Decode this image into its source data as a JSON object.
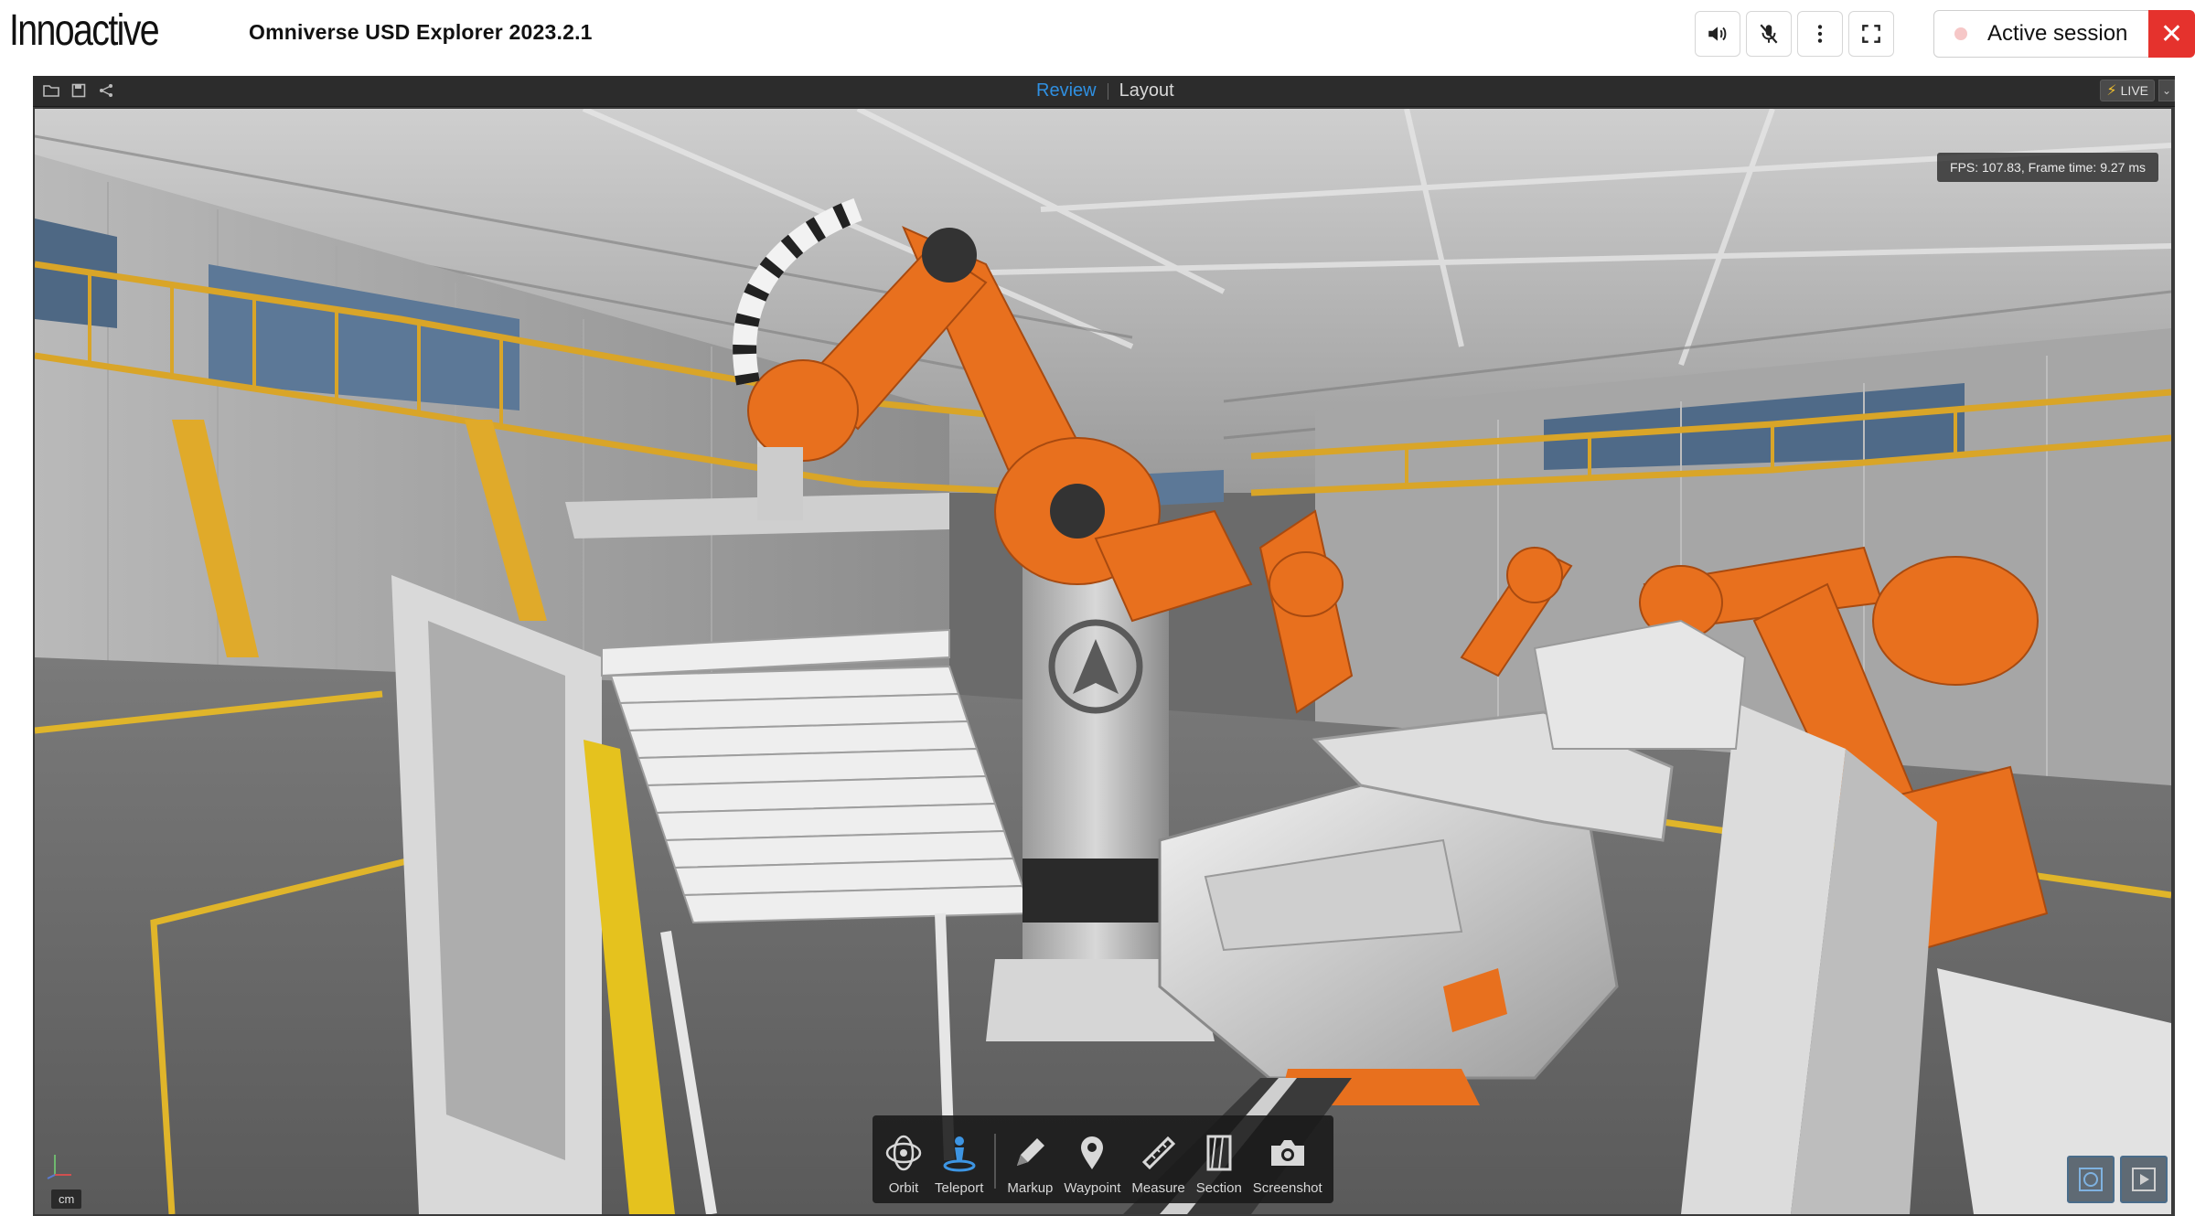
{
  "brand": {
    "logo_text": "Innoactive"
  },
  "header": {
    "app_title": "Omniverse USD Explorer 2023.2.1",
    "session_label": "Active session",
    "close_glyph": "✕",
    "controls": [
      {
        "name": "speaker-icon"
      },
      {
        "name": "mic-muted-icon"
      },
      {
        "name": "more-vertical-icon"
      },
      {
        "name": "fullscreen-icon"
      }
    ],
    "accent_color": "#e5322d"
  },
  "app": {
    "toolbar_icons": [
      "folder-open-icon",
      "save-icon",
      "share-icon"
    ],
    "tabs": [
      {
        "label": "Review",
        "active": true
      },
      {
        "label": "Layout",
        "active": false
      }
    ],
    "live_label": "LIVE",
    "live_dropdown_glyph": "⌄",
    "fps_text": "FPS: 107.83, Frame time: 9.27 ms",
    "unit_label": "cm",
    "tools": [
      {
        "label": "Orbit",
        "icon": "orbit-icon",
        "active": false
      },
      {
        "label": "Teleport",
        "icon": "teleport-icon",
        "active": true
      },
      {
        "label": "Markup",
        "icon": "pencil-icon",
        "active": false
      },
      {
        "label": "Waypoint",
        "icon": "map-pin-icon",
        "active": false
      },
      {
        "label": "Measure",
        "icon": "ruler-icon",
        "active": false
      },
      {
        "label": "Section",
        "icon": "section-icon",
        "active": false
      },
      {
        "label": "Screenshot",
        "icon": "camera-icon",
        "active": false
      }
    ],
    "tab_active_color": "#2f8fe0",
    "robot_color": "#e8701e"
  }
}
